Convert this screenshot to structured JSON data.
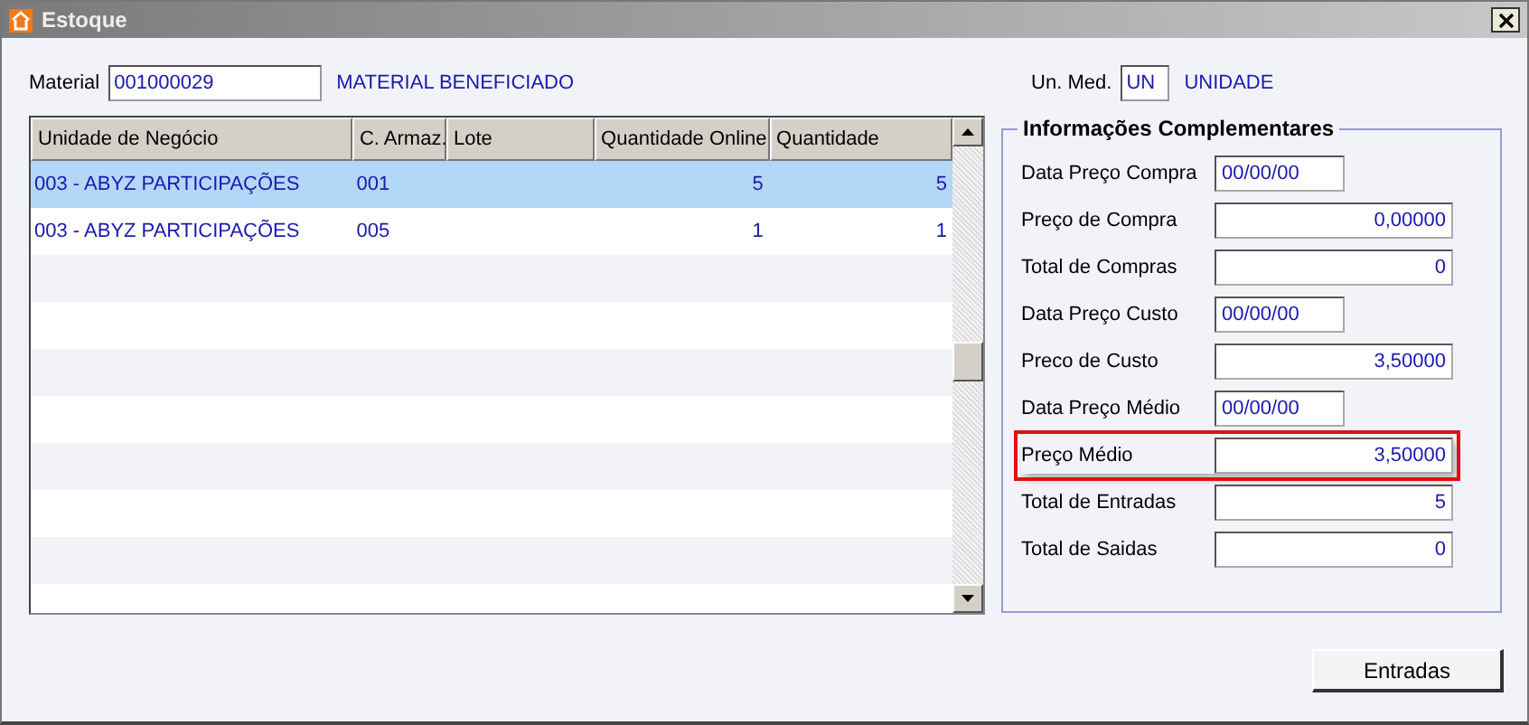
{
  "window": {
    "title": "Estoque"
  },
  "material": {
    "label": "Material",
    "code": "001000029",
    "description": "MATERIAL BENEFICIADO"
  },
  "unit": {
    "label": "Un. Med.",
    "code": "UN",
    "description": "UNIDADE"
  },
  "table": {
    "columns": [
      "Unidade de Negócio",
      "C. Armaz.",
      "Lote",
      "Quantidade Online",
      "Quantidade"
    ],
    "rows": [
      {
        "cells": [
          "003 - ABYZ PARTICIPAÇÕES",
          "001",
          "",
          "5",
          "5"
        ],
        "selected": true
      },
      {
        "cells": [
          "003 - ABYZ PARTICIPAÇÕES",
          "005",
          "",
          "1",
          "1"
        ],
        "selected": false
      }
    ]
  },
  "info": {
    "title": "Informações Complementares",
    "fields": [
      {
        "label": "Data Preço Compra",
        "value": "00/00/00",
        "kind": "date",
        "highlighted": false
      },
      {
        "label": "Preço de Compra",
        "value": "0,00000",
        "kind": "number",
        "highlighted": false
      },
      {
        "label": "Total de Compras",
        "value": "0",
        "kind": "number",
        "highlighted": false
      },
      {
        "label": "Data Preço Custo",
        "value": "00/00/00",
        "kind": "date",
        "highlighted": false
      },
      {
        "label": "Preco de Custo",
        "value": "3,50000",
        "kind": "number",
        "highlighted": false
      },
      {
        "label": "Data Preço Médio",
        "value": "00/00/00",
        "kind": "date",
        "highlighted": false
      },
      {
        "label": "Preço Médio",
        "value": "3,50000",
        "kind": "number",
        "highlighted": true
      },
      {
        "label": "Total de Entradas",
        "value": "5",
        "kind": "number",
        "highlighted": false
      },
      {
        "label": "Total de Saidas",
        "value": "0",
        "kind": "number",
        "highlighted": false
      }
    ]
  },
  "buttons": [
    "Entradas"
  ]
}
